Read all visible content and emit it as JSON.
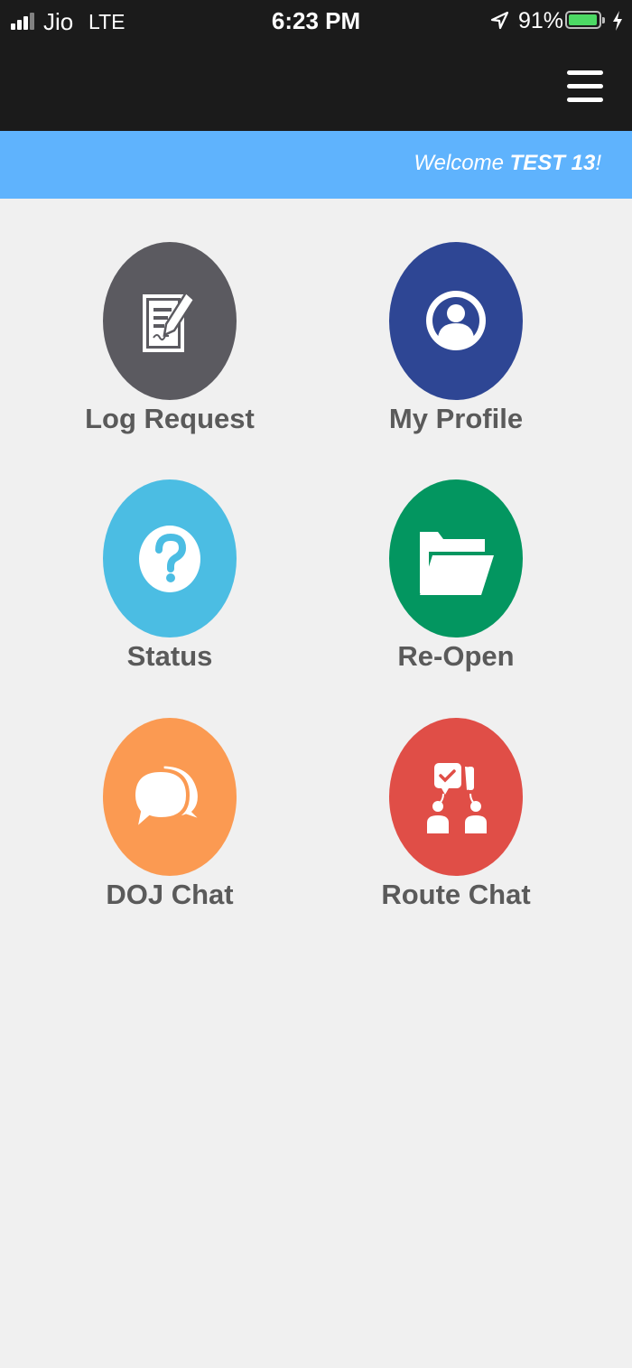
{
  "status_bar": {
    "carrier": "Jio",
    "network": "LTE",
    "time": "6:23 PM",
    "battery_percent": "91%",
    "battery_level": 0.91,
    "battery_color": "#4cd964"
  },
  "header": {
    "menu_icon": "hamburger-menu-icon",
    "background_color": "#1b1b1b"
  },
  "welcome": {
    "prefix": "Welcome ",
    "user": "TEST 13",
    "suffix": "!",
    "background_color": "#5fb3fd"
  },
  "tiles": [
    {
      "label": "Log Request",
      "icon": "document-edit-icon",
      "color": "#5b5a60"
    },
    {
      "label": "My Profile",
      "icon": "user-profile-icon",
      "color": "#2e4694"
    },
    {
      "label": "Status",
      "icon": "question-icon",
      "color": "#4bbde3"
    },
    {
      "label": "Re-Open",
      "icon": "folder-open-icon",
      "color": "#039660"
    },
    {
      "label": "DOJ Chat",
      "icon": "chat-bubbles-icon",
      "color": "#fb9a52"
    },
    {
      "label": "Route Chat",
      "icon": "route-chat-icon",
      "color": "#e04e47"
    }
  ]
}
